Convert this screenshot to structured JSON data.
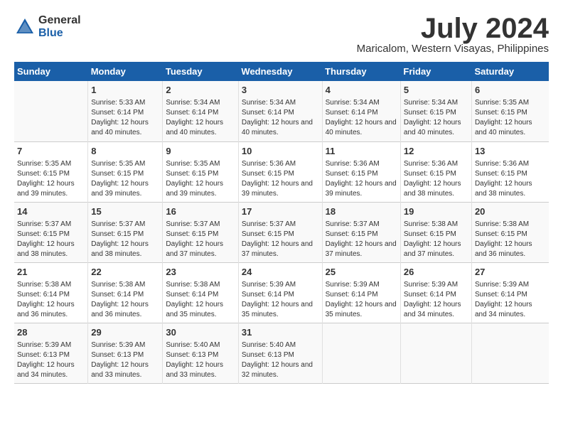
{
  "header": {
    "logo_general": "General",
    "logo_blue": "Blue",
    "month": "July 2024",
    "location": "Maricalom, Western Visayas, Philippines"
  },
  "days_of_week": [
    "Sunday",
    "Monday",
    "Tuesday",
    "Wednesday",
    "Thursday",
    "Friday",
    "Saturday"
  ],
  "weeks": [
    [
      {
        "day": "",
        "sunrise": "",
        "sunset": "",
        "daylight": ""
      },
      {
        "day": "1",
        "sunrise": "Sunrise: 5:33 AM",
        "sunset": "Sunset: 6:14 PM",
        "daylight": "Daylight: 12 hours and 40 minutes."
      },
      {
        "day": "2",
        "sunrise": "Sunrise: 5:34 AM",
        "sunset": "Sunset: 6:14 PM",
        "daylight": "Daylight: 12 hours and 40 minutes."
      },
      {
        "day": "3",
        "sunrise": "Sunrise: 5:34 AM",
        "sunset": "Sunset: 6:14 PM",
        "daylight": "Daylight: 12 hours and 40 minutes."
      },
      {
        "day": "4",
        "sunrise": "Sunrise: 5:34 AM",
        "sunset": "Sunset: 6:14 PM",
        "daylight": "Daylight: 12 hours and 40 minutes."
      },
      {
        "day": "5",
        "sunrise": "Sunrise: 5:34 AM",
        "sunset": "Sunset: 6:15 PM",
        "daylight": "Daylight: 12 hours and 40 minutes."
      },
      {
        "day": "6",
        "sunrise": "Sunrise: 5:35 AM",
        "sunset": "Sunset: 6:15 PM",
        "daylight": "Daylight: 12 hours and 40 minutes."
      }
    ],
    [
      {
        "day": "7",
        "sunrise": "Sunrise: 5:35 AM",
        "sunset": "Sunset: 6:15 PM",
        "daylight": "Daylight: 12 hours and 39 minutes."
      },
      {
        "day": "8",
        "sunrise": "Sunrise: 5:35 AM",
        "sunset": "Sunset: 6:15 PM",
        "daylight": "Daylight: 12 hours and 39 minutes."
      },
      {
        "day": "9",
        "sunrise": "Sunrise: 5:35 AM",
        "sunset": "Sunset: 6:15 PM",
        "daylight": "Daylight: 12 hours and 39 minutes."
      },
      {
        "day": "10",
        "sunrise": "Sunrise: 5:36 AM",
        "sunset": "Sunset: 6:15 PM",
        "daylight": "Daylight: 12 hours and 39 minutes."
      },
      {
        "day": "11",
        "sunrise": "Sunrise: 5:36 AM",
        "sunset": "Sunset: 6:15 PM",
        "daylight": "Daylight: 12 hours and 39 minutes."
      },
      {
        "day": "12",
        "sunrise": "Sunrise: 5:36 AM",
        "sunset": "Sunset: 6:15 PM",
        "daylight": "Daylight: 12 hours and 38 minutes."
      },
      {
        "day": "13",
        "sunrise": "Sunrise: 5:36 AM",
        "sunset": "Sunset: 6:15 PM",
        "daylight": "Daylight: 12 hours and 38 minutes."
      }
    ],
    [
      {
        "day": "14",
        "sunrise": "Sunrise: 5:37 AM",
        "sunset": "Sunset: 6:15 PM",
        "daylight": "Daylight: 12 hours and 38 minutes."
      },
      {
        "day": "15",
        "sunrise": "Sunrise: 5:37 AM",
        "sunset": "Sunset: 6:15 PM",
        "daylight": "Daylight: 12 hours and 38 minutes."
      },
      {
        "day": "16",
        "sunrise": "Sunrise: 5:37 AM",
        "sunset": "Sunset: 6:15 PM",
        "daylight": "Daylight: 12 hours and 37 minutes."
      },
      {
        "day": "17",
        "sunrise": "Sunrise: 5:37 AM",
        "sunset": "Sunset: 6:15 PM",
        "daylight": "Daylight: 12 hours and 37 minutes."
      },
      {
        "day": "18",
        "sunrise": "Sunrise: 5:37 AM",
        "sunset": "Sunset: 6:15 PM",
        "daylight": "Daylight: 12 hours and 37 minutes."
      },
      {
        "day": "19",
        "sunrise": "Sunrise: 5:38 AM",
        "sunset": "Sunset: 6:15 PM",
        "daylight": "Daylight: 12 hours and 37 minutes."
      },
      {
        "day": "20",
        "sunrise": "Sunrise: 5:38 AM",
        "sunset": "Sunset: 6:15 PM",
        "daylight": "Daylight: 12 hours and 36 minutes."
      }
    ],
    [
      {
        "day": "21",
        "sunrise": "Sunrise: 5:38 AM",
        "sunset": "Sunset: 6:14 PM",
        "daylight": "Daylight: 12 hours and 36 minutes."
      },
      {
        "day": "22",
        "sunrise": "Sunrise: 5:38 AM",
        "sunset": "Sunset: 6:14 PM",
        "daylight": "Daylight: 12 hours and 36 minutes."
      },
      {
        "day": "23",
        "sunrise": "Sunrise: 5:38 AM",
        "sunset": "Sunset: 6:14 PM",
        "daylight": "Daylight: 12 hours and 35 minutes."
      },
      {
        "day": "24",
        "sunrise": "Sunrise: 5:39 AM",
        "sunset": "Sunset: 6:14 PM",
        "daylight": "Daylight: 12 hours and 35 minutes."
      },
      {
        "day": "25",
        "sunrise": "Sunrise: 5:39 AM",
        "sunset": "Sunset: 6:14 PM",
        "daylight": "Daylight: 12 hours and 35 minutes."
      },
      {
        "day": "26",
        "sunrise": "Sunrise: 5:39 AM",
        "sunset": "Sunset: 6:14 PM",
        "daylight": "Daylight: 12 hours and 34 minutes."
      },
      {
        "day": "27",
        "sunrise": "Sunrise: 5:39 AM",
        "sunset": "Sunset: 6:14 PM",
        "daylight": "Daylight: 12 hours and 34 minutes."
      }
    ],
    [
      {
        "day": "28",
        "sunrise": "Sunrise: 5:39 AM",
        "sunset": "Sunset: 6:13 PM",
        "daylight": "Daylight: 12 hours and 34 minutes."
      },
      {
        "day": "29",
        "sunrise": "Sunrise: 5:39 AM",
        "sunset": "Sunset: 6:13 PM",
        "daylight": "Daylight: 12 hours and 33 minutes."
      },
      {
        "day": "30",
        "sunrise": "Sunrise: 5:40 AM",
        "sunset": "Sunset: 6:13 PM",
        "daylight": "Daylight: 12 hours and 33 minutes."
      },
      {
        "day": "31",
        "sunrise": "Sunrise: 5:40 AM",
        "sunset": "Sunset: 6:13 PM",
        "daylight": "Daylight: 12 hours and 32 minutes."
      },
      {
        "day": "",
        "sunrise": "",
        "sunset": "",
        "daylight": ""
      },
      {
        "day": "",
        "sunrise": "",
        "sunset": "",
        "daylight": ""
      },
      {
        "day": "",
        "sunrise": "",
        "sunset": "",
        "daylight": ""
      }
    ]
  ]
}
